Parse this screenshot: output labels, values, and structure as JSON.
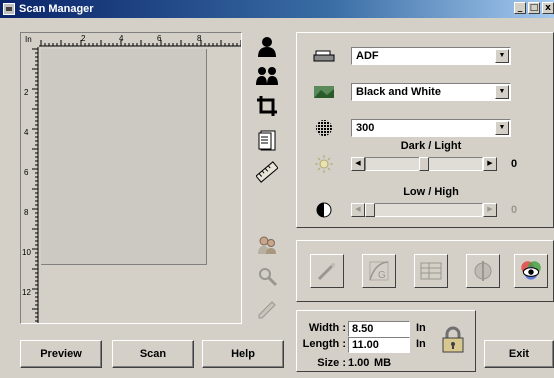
{
  "window": {
    "title": "Scan Manager",
    "controls": [
      "minimize",
      "maximize",
      "close"
    ]
  },
  "ruler": {
    "top_labels": [
      "In",
      "2",
      "4",
      "6",
      "8"
    ],
    "left_labels": [
      "2",
      "4",
      "6",
      "8",
      "10",
      "12"
    ]
  },
  "tools": [
    {
      "name": "single-person-icon"
    },
    {
      "name": "group-people-icon"
    },
    {
      "name": "crop-icon"
    },
    {
      "name": "paper-size-icon"
    },
    {
      "name": "ruler-icon"
    },
    {
      "name": "photo-people-icon"
    },
    {
      "name": "zoom-icon"
    },
    {
      "name": "pen-icon"
    }
  ],
  "settings": {
    "source": "ADF",
    "mode": "Black and White",
    "resolution": "300",
    "brightness_label": "Dark / Light",
    "brightness_value": "0",
    "brightness_level": 0.5,
    "contrast_label": "Low / High",
    "contrast_value": "0",
    "contrast_level": 0.0
  },
  "size": {
    "width_label": "Width :",
    "width_value": "8.50",
    "width_unit": "In",
    "length_label": "Length :",
    "length_value": "11.00",
    "length_unit": "In",
    "size_label": "Size :",
    "size_value": "1.00",
    "size_unit": "MB"
  },
  "buttons": {
    "preview": "Preview",
    "scan": "Scan",
    "help": "Help",
    "exit": "Exit"
  }
}
